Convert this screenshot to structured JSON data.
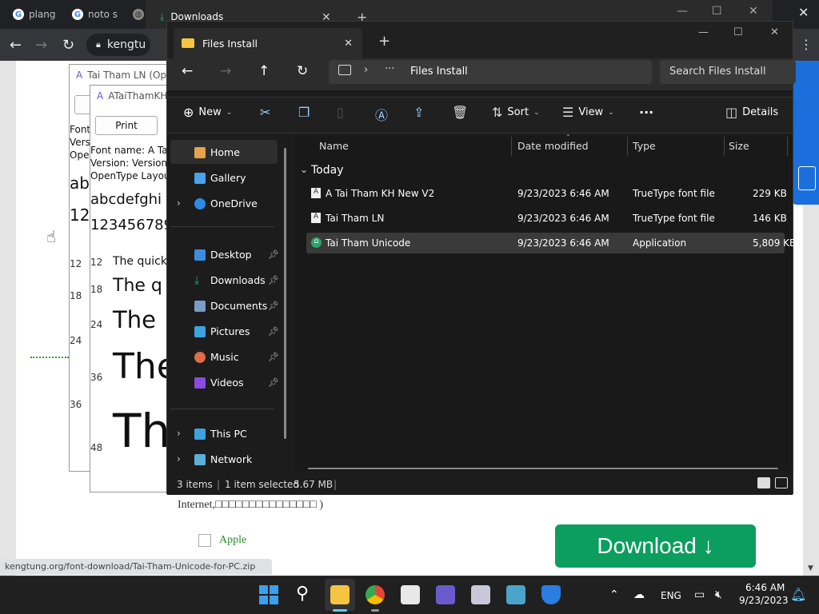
{
  "chrome": {
    "tabs": [
      {
        "label": "plang"
      },
      {
        "label": "noto s"
      }
    ],
    "url": "kengtu",
    "status_url": "kengtung.org/font-download/Tai-Tham-Unicode-for-PC.zip"
  },
  "downloads_window": {
    "title": "Downloads"
  },
  "webpage": {
    "internet_text": "Internet,□□□□□□□□□□□□□□□ )",
    "apple_text": "Apple",
    "download_button": "Download ↓"
  },
  "font_windows": [
    {
      "title": "Tai Tham LN (Ope",
      "lines": [
        "Font",
        "Vers",
        "Oper"
      ],
      "sample_lower": "ab",
      "sample_digits": "12",
      "sizes": [
        "12",
        "18",
        "24",
        "36"
      ]
    },
    {
      "title": "ATaiThamKH",
      "print_label": "Print",
      "info": [
        "Font name: A Tai",
        "Version: Version",
        "OpenType Layou"
      ],
      "sample_lower": "abcdefghi",
      "sample_digits": "123456789",
      "sizes": [
        "12",
        "18",
        "24",
        "36",
        "48"
      ],
      "preview_text": "The quick",
      "preview_short": "The q",
      "preview_word": "The"
    }
  ],
  "explorer": {
    "tab_title": "Files Install",
    "address": "Files Install",
    "search_placeholder": "Search Files Install",
    "commands": {
      "new": "New",
      "sort": "Sort",
      "view": "View",
      "details": "Details"
    },
    "sidebar": [
      {
        "label": "Home",
        "pinned": false
      },
      {
        "label": "Gallery",
        "pinned": false
      },
      {
        "label": "OneDrive",
        "pinned": false
      },
      {
        "label": "Desktop",
        "pinned": true
      },
      {
        "label": "Downloads",
        "pinned": true
      },
      {
        "label": "Documents",
        "pinned": true
      },
      {
        "label": "Pictures",
        "pinned": true
      },
      {
        "label": "Music",
        "pinned": true
      },
      {
        "label": "Videos",
        "pinned": true
      },
      {
        "label": "This PC",
        "pinned": false
      },
      {
        "label": "Network",
        "pinned": false
      }
    ],
    "columns": [
      "Name",
      "Date modified",
      "Type",
      "Size"
    ],
    "group": "Today",
    "files": [
      {
        "name": "A Tai Tham KH New V2",
        "date": "9/23/2023 6:46 AM",
        "type": "TrueType font file",
        "size": "229 KB"
      },
      {
        "name": "Tai Tham LN",
        "date": "9/23/2023 6:46 AM",
        "type": "TrueType font file",
        "size": "146 KB"
      },
      {
        "name": "Tai Tham Unicode",
        "date": "9/23/2023 6:46 AM",
        "type": "Application",
        "size": "5,809 KB"
      }
    ],
    "status": {
      "count": "3 items",
      "selected": "1 item selected",
      "size": "5.67 MB"
    }
  },
  "taskbar": {
    "lang": "ENG",
    "time": "6:46 AM",
    "date": "9/23/2023"
  }
}
